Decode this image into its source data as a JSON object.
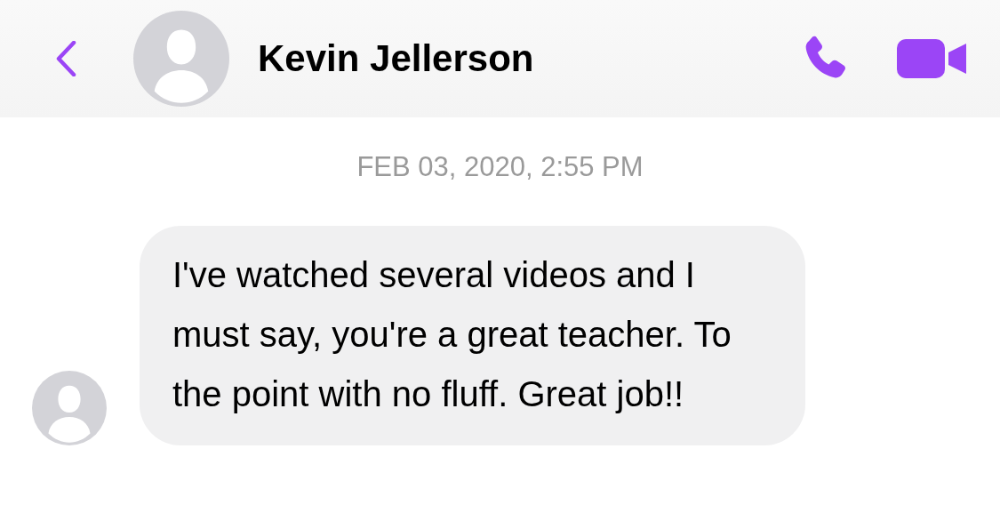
{
  "header": {
    "contact_name": "Kevin Jellerson"
  },
  "timestamp": "FEB 03, 2020, 2:55 PM",
  "messages": [
    {
      "text": "I've watched several videos and I must say, you're a great teacher. To the point with no fluff. Great job!!",
      "incoming": true
    }
  ]
}
